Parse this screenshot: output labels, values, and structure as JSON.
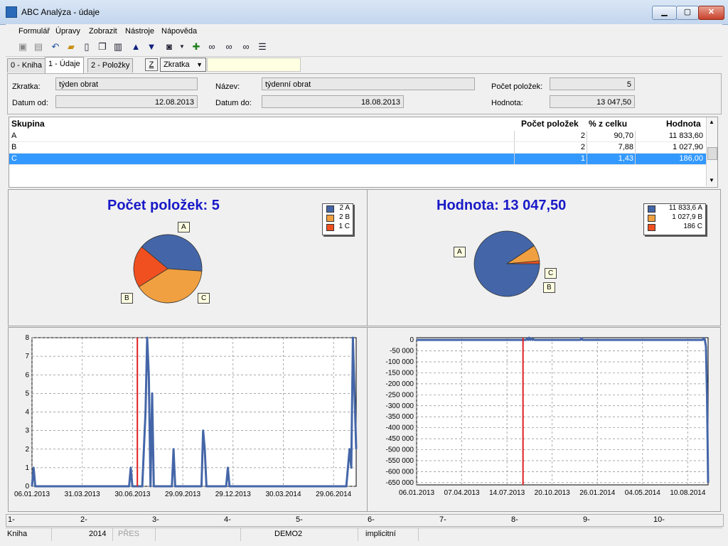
{
  "window": {
    "title": "ABC Analýza - údaje",
    "min": "▁",
    "max": "▢",
    "close": "✕"
  },
  "menu": [
    "Formulář",
    "Úpravy",
    "Zobrazit",
    "Nástroje",
    "Nápověda"
  ],
  "toolbar_icons": [
    "save-icon",
    "save-all-icon",
    "undo-icon",
    "open-folder-icon",
    "new-doc-icon",
    "copy-icon",
    "book-icon",
    "arrow-up-icon",
    "arrow-down-icon",
    "camera-icon",
    "dropdown-icon",
    "filter-icon",
    "binoculars-icon",
    "binoculars-next-icon",
    "binoculars-prev-icon",
    "menu-lines-icon"
  ],
  "tabs": [
    "0 - Kniha",
    "1 - Údaje",
    "2 - Položky"
  ],
  "tab_z": "Z",
  "zkratka_select": "Zkratka",
  "form": {
    "zkratka_label": "Zkratka:",
    "zkratka_value": "týden obrat",
    "nazev_label": "Název:",
    "nazev_value": "týdenní obrat",
    "pocet_label": "Počet položek:",
    "pocet_value": "5",
    "datum_od_label": "Datum od:",
    "datum_od_value": "12.08.2013",
    "datum_do_label": "Datum do:",
    "datum_do_value": "18.08.2013",
    "hodnota_label": "Hodnota:",
    "hodnota_value": "13 047,50"
  },
  "grid": {
    "headers": [
      "Skupina",
      "Počet položek",
      "% z celku",
      "Hodnota"
    ],
    "rows": [
      [
        "A",
        "2",
        "90,70",
        "11 833,60"
      ],
      [
        "B",
        "2",
        "7,88",
        "1 027,90"
      ],
      [
        "C",
        "1",
        "1,43",
        "186,00"
      ]
    ],
    "selected_index": 2
  },
  "pie_left": {
    "title": "Počet položek: 5",
    "legend": [
      "2 A",
      "2 B",
      "1 C"
    ],
    "labels": [
      "A",
      "B",
      "C"
    ]
  },
  "pie_right": {
    "title": "Hodnota: 13 047,50",
    "legend": [
      "11 833,6 A",
      "1 027,9 B",
      "186 C"
    ],
    "labels": [
      "A",
      "B",
      "C"
    ]
  },
  "colors": {
    "A": "#4466a8",
    "B": "#f0a040",
    "C": "#f05020",
    "accent": "#1919c8",
    "marker": "#e02020",
    "selection": "#3399ff"
  },
  "chart_data": [
    {
      "type": "pie",
      "title": "Počet položek: 5",
      "categories": [
        "A",
        "B",
        "C"
      ],
      "values": [
        2,
        2,
        1
      ]
    },
    {
      "type": "pie",
      "title": "Hodnota: 13 047,50",
      "categories": [
        "A",
        "B",
        "C"
      ],
      "values": [
        11833.6,
        1027.9,
        186
      ]
    },
    {
      "type": "line",
      "y_ticks": [
        "0",
        "1",
        "2",
        "3",
        "4",
        "5",
        "6",
        "7",
        "8"
      ],
      "x_ticks": [
        "06.01.2013",
        "31.03.2013",
        "30.06.2013",
        "29.09.2013",
        "29.12.2013",
        "30.03.2014",
        "29.06.2014"
      ],
      "ylim": [
        0,
        8
      ],
      "grid": true,
      "marker_x": 0.325,
      "series": [
        {
          "values": [
            0,
            1,
            0,
            0,
            0,
            0,
            0,
            0,
            0,
            0,
            0,
            0,
            0,
            0,
            0,
            0,
            0,
            0,
            0,
            0,
            0,
            0,
            0,
            0,
            0,
            0,
            0,
            0,
            0,
            0,
            0,
            0,
            0,
            0,
            0,
            0,
            0,
            0,
            0,
            0,
            0,
            0,
            0,
            0,
            0,
            0,
            0,
            0,
            0,
            0,
            0,
            0,
            0,
            0,
            0,
            0,
            0,
            0,
            0,
            0,
            1,
            0,
            0,
            0,
            0,
            0,
            0,
            0,
            2,
            4,
            8,
            6,
            0,
            5,
            0,
            0,
            0,
            0,
            0,
            0,
            0,
            0,
            0,
            0,
            0,
            0,
            2,
            0,
            0,
            0,
            0,
            0,
            0,
            0,
            0,
            0,
            0,
            0,
            0,
            0,
            0,
            0,
            0,
            0,
            3,
            2,
            0,
            0,
            0,
            0,
            0,
            0,
            0,
            0,
            0,
            0,
            0,
            0,
            0,
            1,
            0,
            0,
            0,
            0,
            0,
            0,
            0,
            0,
            0,
            0,
            0,
            0,
            0,
            0,
            0,
            0,
            0,
            0,
            0,
            0,
            0,
            0,
            0,
            0,
            0,
            0,
            0,
            0,
            0,
            0,
            0,
            0,
            0,
            0,
            0,
            0,
            0,
            0,
            0,
            0,
            0,
            0,
            0,
            0,
            0,
            0,
            0,
            0,
            0,
            0,
            0,
            0,
            0,
            0,
            0,
            0,
            0,
            0,
            0,
            0,
            0,
            0,
            0,
            0,
            0,
            0,
            0,
            0,
            0,
            0,
            0,
            0,
            1,
            2,
            1,
            8,
            5,
            2
          ]
        }
      ]
    },
    {
      "type": "line",
      "y_ticks": [
        "0",
        "-50 000",
        "-100 000",
        "-150 000",
        "-200 000",
        "-250 000",
        "-300 000",
        "-350 000",
        "-400 000",
        "-450 000",
        "-500 000",
        "-550 000",
        "-600 000",
        "-650 000"
      ],
      "x_ticks": [
        "06.01.2013",
        "07.04.2013",
        "14.07.2013",
        "20.10.2013",
        "26.01.2014",
        "04.05.2014",
        "10.08.2014"
      ],
      "ylim": [
        -660000,
        10000
      ],
      "grid": true,
      "marker_x": 0.365,
      "series": [
        {
          "values": [
            0,
            0,
            0,
            0,
            0,
            0,
            0,
            0,
            0,
            0,
            0,
            0,
            0,
            0,
            0,
            0,
            0,
            0,
            0,
            0,
            0,
            0,
            0,
            0,
            0,
            0,
            0,
            0,
            0,
            0,
            0,
            0,
            0,
            0,
            0,
            0,
            0,
            0,
            0,
            0,
            0,
            0,
            0,
            0,
            0,
            0,
            0,
            0,
            0,
            0,
            0,
            0,
            0,
            0,
            0,
            0,
            0,
            0,
            0,
            0,
            0,
            0,
            0,
            0,
            0,
            0,
            0,
            0,
            0,
            0,
            0,
            0,
            0,
            0,
            0,
            0,
            0,
            0,
            0,
            0,
            0,
            0,
            0,
            0,
            0,
            0,
            0,
            0,
            0,
            0,
            0,
            0,
            0,
            0,
            0,
            0,
            0,
            0,
            0,
            0,
            0,
            0,
            0,
            5000,
            0,
            10000,
            0,
            6000,
            0,
            3000,
            0,
            0,
            0,
            0,
            0,
            0,
            0,
            0,
            0,
            0,
            0,
            0,
            0,
            0,
            0,
            0,
            0,
            0,
            0,
            0,
            0,
            0,
            0,
            0,
            0,
            0,
            0,
            0,
            0,
            0,
            0,
            0,
            0,
            0,
            0,
            0,
            0,
            0,
            0,
            0,
            0,
            0,
            0,
            0,
            7000,
            0,
            0,
            0,
            0,
            0,
            0,
            0,
            0,
            0,
            0,
            0,
            0,
            0,
            0,
            0,
            0,
            0,
            0,
            0,
            0,
            0,
            0,
            0,
            0,
            0,
            0,
            0,
            0,
            0,
            0,
            0,
            0,
            0,
            0,
            0,
            0,
            0,
            0,
            0,
            0,
            0,
            0,
            0,
            0,
            0,
            0,
            0,
            0,
            0,
            0,
            0,
            0,
            0,
            0,
            0,
            0,
            0,
            0,
            0,
            0,
            0,
            0,
            0,
            0,
            0,
            0,
            0,
            0,
            0,
            0,
            0,
            0,
            0,
            0,
            0,
            0,
            0,
            0,
            0,
            0,
            0,
            0,
            0,
            0,
            0,
            0,
            0,
            0,
            0,
            0,
            0,
            0,
            0,
            0,
            0,
            0,
            0,
            0,
            0,
            0,
            0,
            0,
            0,
            0,
            0,
            0,
            0,
            0,
            0,
            0,
            0,
            0,
            0,
            8000,
            0,
            -30000,
            -260000,
            -650000
          ]
        }
      ]
    }
  ],
  "slots": [
    "1-",
    "2-",
    "3-",
    "4-",
    "5-",
    "6-",
    "7-",
    "8-",
    "9-",
    "10-"
  ],
  "status": [
    "Kniha",
    "2014",
    "PŘES",
    "DEMO2",
    "implicitní"
  ]
}
